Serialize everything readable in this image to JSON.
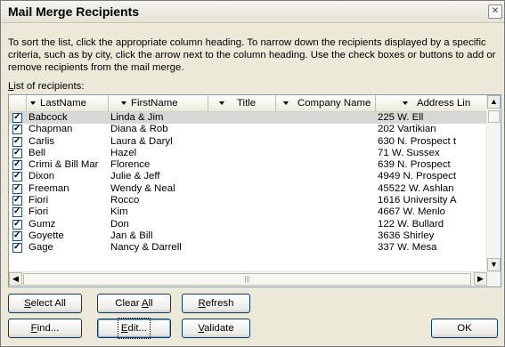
{
  "window": {
    "title": "Mail Merge Recipients"
  },
  "instructions": "To sort the list, click the appropriate column heading.  To narrow down the recipients displayed by a specific criteria, such as by city, click the arrow next to the column heading.  Use the check boxes or buttons to add or remove recipients from the mail merge.",
  "list_label": {
    "mnemonic": "L",
    "rest": "ist of recipients:"
  },
  "columns": [
    "LastName",
    "FirstName",
    "Title",
    "Company Name",
    "Address Lin"
  ],
  "rows": [
    {
      "last": "Babcock",
      "first": "Linda & Jim",
      "title": "",
      "company": "",
      "address": "225 W. Ell",
      "checked": true
    },
    {
      "last": "Chapman",
      "first": "Diana & Rob",
      "title": "",
      "company": "",
      "address": "202 Vartikian",
      "checked": true
    },
    {
      "last": "Carlis",
      "first": "Laura & Daryl",
      "title": "",
      "company": "",
      "address": "630 N. Prospect t",
      "checked": true
    },
    {
      "last": "Bell",
      "first": "Hazel",
      "title": "",
      "company": "",
      "address": "71 W. Sussex",
      "checked": true
    },
    {
      "last": "Crimi & Bill Mar",
      "first": "Florence",
      "title": "",
      "company": "",
      "address": "639 N. Prospect",
      "checked": true
    },
    {
      "last": "Dixon",
      "first": "Julie & Jeff",
      "title": "",
      "company": "",
      "address": "4949 N. Prospect",
      "checked": true
    },
    {
      "last": "Freeman",
      "first": "Wendy & Neal",
      "title": "",
      "company": "",
      "address": "45522 W. Ashlan",
      "checked": true
    },
    {
      "last": "Fiori",
      "first": "Rocco",
      "title": "",
      "company": "",
      "address": "1616 University A",
      "checked": true
    },
    {
      "last": "Fiori",
      "first": "Kim",
      "title": "",
      "company": "",
      "address": "4667 W. Menlo",
      "checked": true
    },
    {
      "last": "Gumz",
      "first": "Don",
      "title": "",
      "company": "",
      "address": "122 W. Bullard",
      "checked": true
    },
    {
      "last": "Goyette",
      "first": "Jan & Bill",
      "title": "",
      "company": "",
      "address": "3636 Shirley",
      "checked": true
    },
    {
      "last": "Gage",
      "first": "Nancy & Darrell",
      "title": "",
      "company": "",
      "address": "337 W. Mesa",
      "checked": true
    }
  ],
  "selected_row_index": 0,
  "buttons": {
    "select_all": {
      "mnemonic": "S",
      "rest": "elect All"
    },
    "clear_all": {
      "pre": "Clear ",
      "mnemonic": "A",
      "rest": "ll"
    },
    "refresh": {
      "mnemonic": "R",
      "rest": "efresh"
    },
    "find": {
      "mnemonic": "F",
      "rest": "ind..."
    },
    "edit": {
      "mnemonic": "E",
      "rest": "dit..."
    },
    "validate": {
      "mnemonic": "V",
      "rest": "alidate"
    },
    "ok": "OK"
  },
  "scroll_glyphs": {
    "up": "▲",
    "down": "▼",
    "left": "◀",
    "right": "▶",
    "grip": "|||",
    "close": "✕"
  }
}
